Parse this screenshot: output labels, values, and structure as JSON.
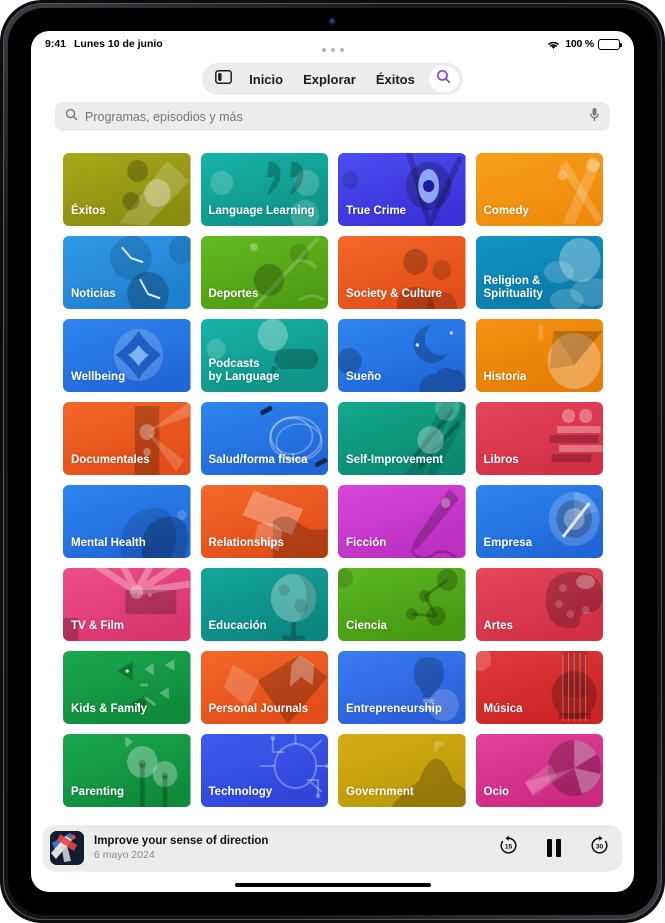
{
  "status_bar": {
    "time": "9:41",
    "date": "Lunes 10 de junio",
    "battery_percent": "100 %",
    "wifi_icon": "wifi-icon",
    "battery_icon": "battery-icon"
  },
  "nav": {
    "sidebar_icon": "sidebar-toggle-icon",
    "items": [
      {
        "label": "Inicio"
      },
      {
        "label": "Explorar"
      },
      {
        "label": "Éxitos"
      }
    ],
    "search_icon": "search-icon",
    "search_icon_color": "#8a3ffc"
  },
  "search": {
    "placeholder": "Programas, episodios y más",
    "search_icon": "search-icon",
    "mic_icon": "microphone-icon"
  },
  "categories": [
    {
      "label": "Éxitos",
      "art": "exitos"
    },
    {
      "label": "Language Learning",
      "art": "language-learning"
    },
    {
      "label": "True Crime",
      "art": "true-crime"
    },
    {
      "label": "Comedy",
      "art": "comedy"
    },
    {
      "label": "Noticias",
      "art": "noticias"
    },
    {
      "label": "Deportes",
      "art": "deportes"
    },
    {
      "label": "Society & Culture",
      "art": "society-culture"
    },
    {
      "label": "Religion &\nSpirituality",
      "art": "religion-spirituality"
    },
    {
      "label": "Wellbeing",
      "art": "wellbeing"
    },
    {
      "label": "Podcasts\nby Language",
      "art": "podcasts-by-language"
    },
    {
      "label": "Sueño",
      "art": "sueno"
    },
    {
      "label": "Historia",
      "art": "historia"
    },
    {
      "label": "Documentales",
      "art": "documentales"
    },
    {
      "label": "Salud/forma física",
      "art": "salud-forma-fisica"
    },
    {
      "label": "Self-Improvement",
      "art": "self-improvement"
    },
    {
      "label": "Libros",
      "art": "libros"
    },
    {
      "label": "Mental Health",
      "art": "mental-health"
    },
    {
      "label": "Relationships",
      "art": "relationships"
    },
    {
      "label": "Ficción",
      "art": "ficcion"
    },
    {
      "label": "Empresa",
      "art": "empresa"
    },
    {
      "label": "TV & Film",
      "art": "tv-film"
    },
    {
      "label": "Educación",
      "art": "educacion"
    },
    {
      "label": "Ciencia",
      "art": "ciencia"
    },
    {
      "label": "Artes",
      "art": "artes"
    },
    {
      "label": "Kids & Family",
      "art": "kids-family"
    },
    {
      "label": "Personal Journals",
      "art": "personal-journals"
    },
    {
      "label": "Entrepreneurship",
      "art": "entrepreneurship"
    },
    {
      "label": "Música",
      "art": "musica"
    },
    {
      "label": "Parenting",
      "art": "parenting"
    },
    {
      "label": "Technology",
      "art": "technology"
    },
    {
      "label": "Government",
      "art": "government"
    },
    {
      "label": "Ocio",
      "art": "ocio"
    }
  ],
  "tile_colors": {
    "exitos": {
      "from": "#a8a81b",
      "to": "#8c8c10"
    },
    "language-learning": {
      "from": "#17b4a8",
      "to": "#0f9287"
    },
    "true-crime": {
      "from": "#4a4ef0",
      "to": "#3a32d8"
    },
    "comedy": {
      "from": "#f9a01b",
      "to": "#ef8a0c"
    },
    "noticias": {
      "from": "#2f9ae8",
      "to": "#1f7fd0"
    },
    "deportes": {
      "from": "#64bb20",
      "to": "#4d9c12"
    },
    "society-culture": {
      "from": "#f4682a",
      "to": "#e24d18"
    },
    "religion-spirituality": {
      "from": "#1295c6",
      "to": "#0b7aa8"
    },
    "wellbeing": {
      "from": "#2e86f0",
      "to": "#2067d8"
    },
    "podcasts-by-language": {
      "from": "#17b4a8",
      "to": "#0f9287"
    },
    "sueno": {
      "from": "#2e86f0",
      "to": "#2067d8"
    },
    "historia": {
      "from": "#f59312",
      "to": "#e67d06"
    },
    "documentales": {
      "from": "#f4682a",
      "to": "#e24d18"
    },
    "salud-forma-fisica": {
      "from": "#2e86f0",
      "to": "#2067d8"
    },
    "self-improvement": {
      "from": "#13a98d",
      "to": "#0b8a72"
    },
    "libros": {
      "from": "#e5465b",
      "to": "#d22f47"
    },
    "mental-health": {
      "from": "#2e86f0",
      "to": "#2067d8"
    },
    "relationships": {
      "from": "#f4682a",
      "to": "#e24d18"
    },
    "ficcion": {
      "from": "#d747d9",
      "to": "#bc2fc2"
    },
    "empresa": {
      "from": "#2e86f0",
      "to": "#2067d8"
    },
    "tv-film": {
      "from": "#ee4e88",
      "to": "#d9356f"
    },
    "educacion": {
      "from": "#14a69c",
      "to": "#0c8780"
    },
    "ciencia": {
      "from": "#5cb820",
      "to": "#469a12"
    },
    "artes": {
      "from": "#e5465b",
      "to": "#d22f47"
    },
    "kids-family": {
      "from": "#1aa84e",
      "to": "#0f8b3c"
    },
    "personal-journals": {
      "from": "#f4682a",
      "to": "#e24d18"
    },
    "entrepreneurship": {
      "from": "#3a7df2",
      "to": "#2a5fd8"
    },
    "musica": {
      "from": "#e03a3a",
      "to": "#cc2424"
    },
    "parenting": {
      "from": "#1aa84e",
      "to": "#0f8b3c"
    },
    "technology": {
      "from": "#3d5cf0",
      "to": "#2f45d8"
    },
    "government": {
      "from": "#d4ae16",
      "to": "#bd990a"
    },
    "ocio": {
      "from": "#e3409a",
      "to": "#cc2a82"
    }
  },
  "player": {
    "title": "Improve your sense of direction",
    "date": "6 mayo 2024",
    "artwork": "podcast-artwork",
    "skip_back_label": "15",
    "skip_forward_label": "30",
    "skip_back_icon": "skip-back-15-icon",
    "play_pause_icon": "pause-icon",
    "skip_forward_icon": "skip-forward-30-icon"
  }
}
